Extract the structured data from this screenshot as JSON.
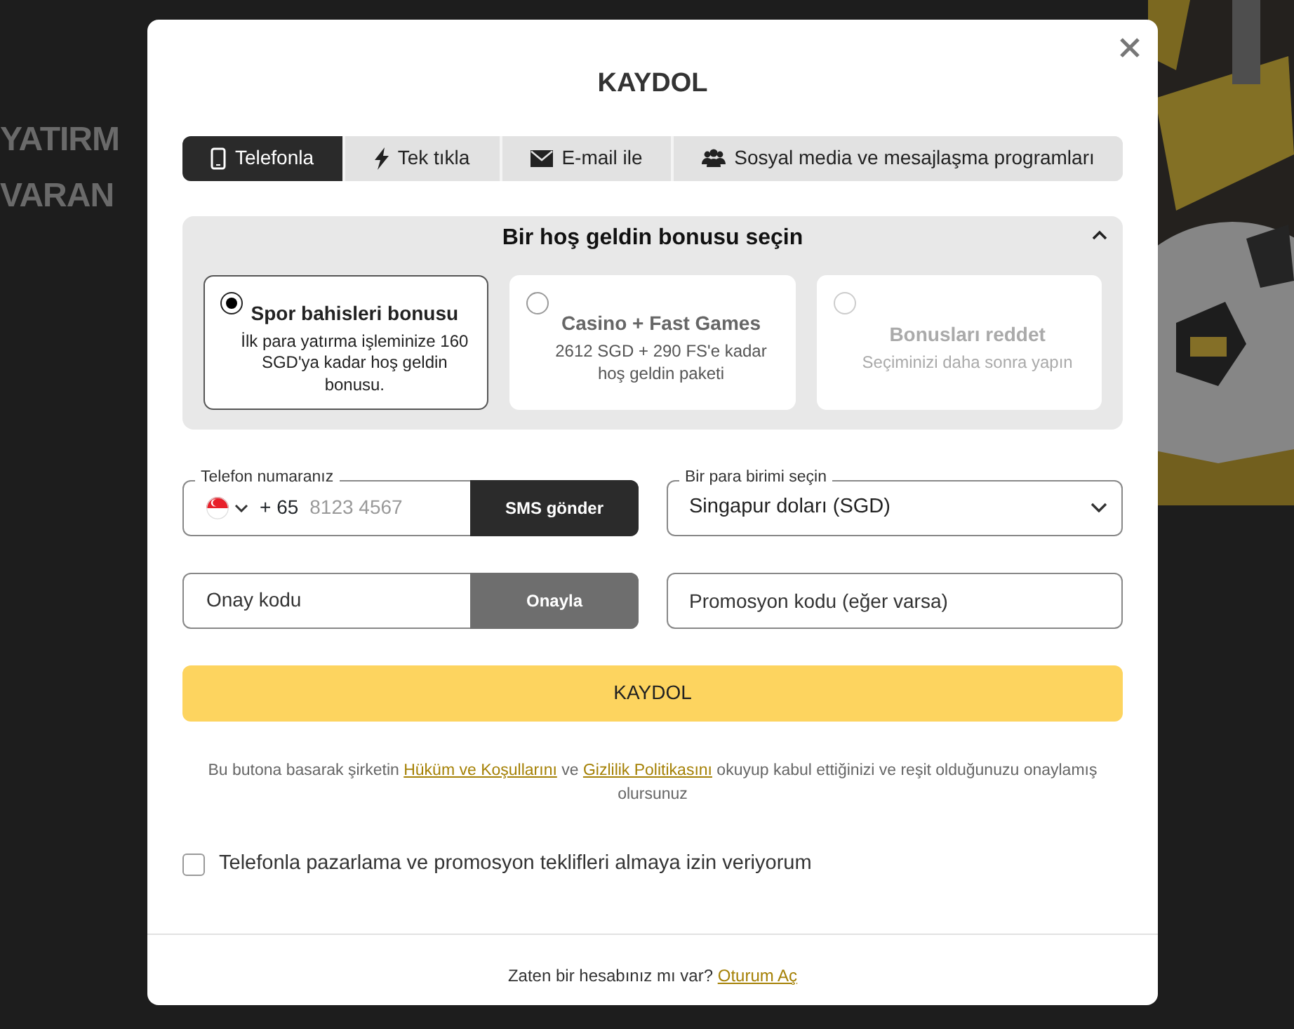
{
  "backdrop": {
    "headline": [
      "YATIRM",
      "VARAN"
    ],
    "image": {
      "kind": "picture"
    }
  },
  "modal": {
    "title": "KAYDOL",
    "tabs": [
      {
        "label": "Telefonla",
        "kind": "phone",
        "selected": true
      },
      {
        "label": "Tek tıkla",
        "kind": "bolt",
        "selected": false
      },
      {
        "label": "E-mail ile",
        "kind": "mail",
        "selected": false
      },
      {
        "label": "Sosyal media ve mesajlaşma programları",
        "kind": "people",
        "selected": false
      }
    ],
    "bonus": {
      "title": "Bir hoş geldin bonusu seçin",
      "expanded": true,
      "options": [
        {
          "title": "Spor bahisleri bonusu",
          "text": "İlk para yatırma işleminize 160 SGD'ya kadar hoş geldin bonusu.",
          "selected": true,
          "disabled": false
        },
        {
          "title": "Casino + Fast Games",
          "text": "2612 SGD + 290 FS'e kadar hoş geldin paketi",
          "selected": false,
          "disabled": false
        },
        {
          "title": "Bonusları reddet",
          "text": "Seçiminizi daha sonra yapın",
          "selected": false,
          "disabled": true
        }
      ]
    },
    "phone": {
      "label": "Telefon numaranız",
      "prefix": "+ 65",
      "placeholder": "8123 4567",
      "button": "SMS gönder"
    },
    "currency": {
      "label": "Bir para birimi seçin",
      "value": "Singapur doları (SGD)"
    },
    "code": {
      "placeholder": "Onay kodu",
      "button": "Onayla",
      "disabled": true
    },
    "promo": {
      "placeholder": "Promosyon kodu (eğer varsa)"
    },
    "submit": "KAYDOL",
    "terms": {
      "before": "Bu butona basarak şirketin",
      "link1": "Hüküm ve Koşullarını",
      "middle": "ve",
      "link2": "Gizlilik Politikasını",
      "after": "okuyup kabul ettiğinizi ve reşit olduğunuzu onaylamış olursunuz"
    },
    "consent": {
      "label": "Telefonla pazarlama ve promosyon teklifleri almaya izin veriyorum",
      "checked": false
    },
    "footer": {
      "text": "Zaten bir hesabınız mı var?",
      "link": "Oturum Aç"
    }
  }
}
